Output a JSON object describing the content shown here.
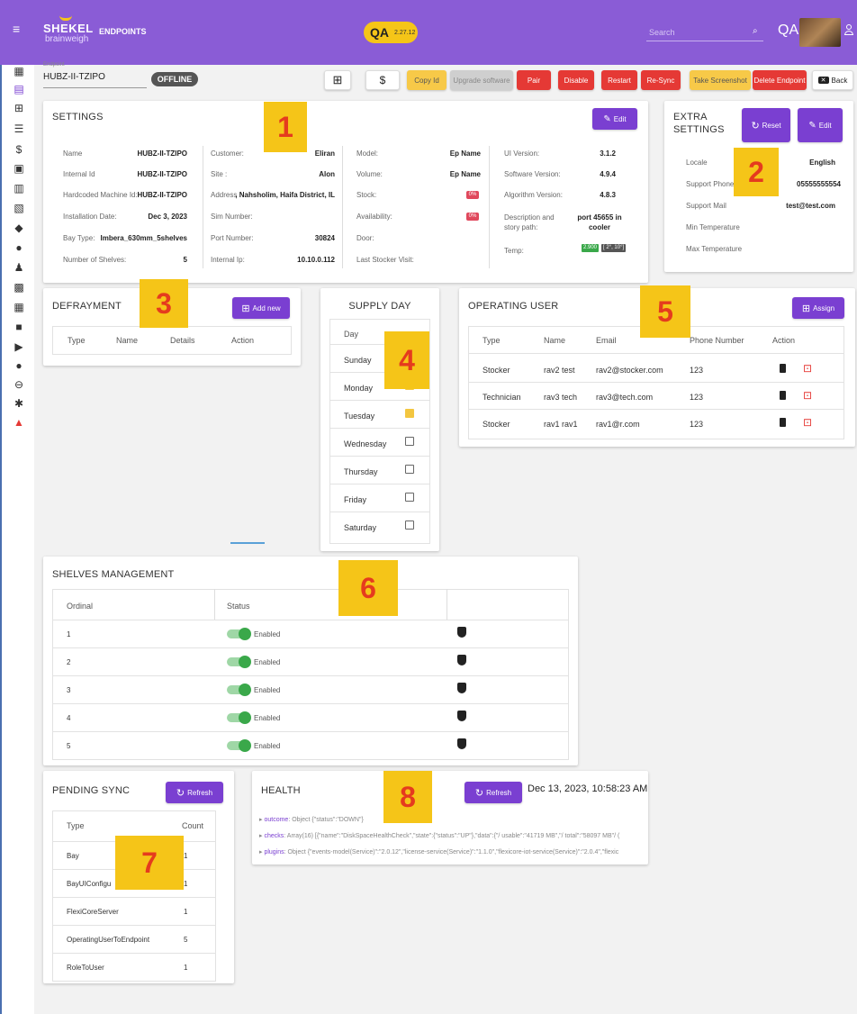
{
  "header": {
    "brand_main": "SHEKEL",
    "brand_sub": "brainweigh",
    "section": "ENDPOINTS",
    "env": "QA",
    "env_version": "2.27.12",
    "search_placeholder": "Search",
    "user_initials": "QA"
  },
  "endpoint": {
    "field_label": "Endpoint",
    "name": "HUBZ-II-TZIPO",
    "status": "OFFLINE"
  },
  "toolbar": {
    "copy_id": "Copy Id",
    "upgrade": "Upgrade software",
    "pair": "Pair",
    "disable": "Disable",
    "restart": "Restart",
    "resync": "Re-Sync",
    "screenshot": "Take Screenshot",
    "delete": "Delete Endpoint",
    "back": "Back",
    "dollar": "$"
  },
  "annotations": [
    "1",
    "2",
    "3",
    "4",
    "5",
    "6",
    "7",
    "8"
  ],
  "settings": {
    "title": "SETTINGS",
    "edit": "Edit",
    "col1": [
      {
        "label": "Name",
        "value": "HUBZ-II-TZIPO"
      },
      {
        "label": "Internal Id",
        "value": "HUBZ-II-TZIPO"
      },
      {
        "label": "Hardcoded Machine Id:",
        "value": "HUBZ-II-TZIPO"
      },
      {
        "label": "Installation Date:",
        "value": "Dec 3, 2023"
      },
      {
        "label": "Bay Type:",
        "value": "Imbera_630mm_5shelves"
      },
      {
        "label": "Number of Shelves:",
        "value": "5"
      }
    ],
    "col2": [
      {
        "label": "Customer:",
        "value": "Eliran"
      },
      {
        "label": "Site :",
        "value": "Alon"
      },
      {
        "label": "Address :",
        "value": ", Nahsholim, Haifa District, IL"
      },
      {
        "label": "Sim Number:",
        "value": ""
      },
      {
        "label": "Port Number:",
        "value": "30824"
      },
      {
        "label": "Internal Ip:",
        "value": "10.10.0.112"
      }
    ],
    "col3": [
      {
        "label": "Model:",
        "value": "Ep Name"
      },
      {
        "label": "Volume:",
        "value": "Ep Name"
      },
      {
        "label": "Stock:",
        "value": "0%"
      },
      {
        "label": "Availability:",
        "value": "0%"
      },
      {
        "label": "Door:",
        "value": ""
      },
      {
        "label": "Last Stocker Visit:",
        "value": ""
      }
    ],
    "col4": [
      {
        "label": "UI Version:",
        "value": "3.1.2"
      },
      {
        "label": "Software Version:",
        "value": "4.9.4"
      },
      {
        "label": "Algorithm Version:",
        "value": "4.8.3"
      },
      {
        "label": "Description and story path:",
        "value": "port 45655 in cooler"
      },
      {
        "label": "Temp:",
        "value": "2.900",
        "range": "[ 2°, 10°]"
      }
    ]
  },
  "extra": {
    "title_1": "EXTRA",
    "title_2": "SETTINGS",
    "reset": "Reset",
    "edit": "Edit",
    "rows": [
      {
        "label": "Locale",
        "value": "English"
      },
      {
        "label": "Support Phone",
        "value": "05555555554"
      },
      {
        "label": "Support Mail",
        "value": "test@test.com"
      },
      {
        "label": "Min Temperature",
        "value": ""
      },
      {
        "label": "Max Temperature",
        "value": ""
      }
    ]
  },
  "defrayment": {
    "title": "DEFRAYMENT",
    "add": "Add new",
    "headers": [
      "Type",
      "Name",
      "Details",
      "Action"
    ]
  },
  "supply": {
    "title": "SUPPLY DAY",
    "header": "Day",
    "days": [
      {
        "name": "Sunday",
        "checked": true
      },
      {
        "name": "Monday",
        "checked": true
      },
      {
        "name": "Tuesday",
        "checked": true
      },
      {
        "name": "Wednesday",
        "checked": false
      },
      {
        "name": "Thursday",
        "checked": false
      },
      {
        "name": "Friday",
        "checked": false
      },
      {
        "name": "Saturday",
        "checked": false
      }
    ]
  },
  "operating": {
    "title": "OPERATING USER",
    "assign": "Assign",
    "headers": [
      "Type",
      "Name",
      "Email",
      "Phone Number",
      "Action"
    ],
    "rows": [
      {
        "type": "Stocker",
        "name": "rav2 test",
        "email": "rav2@stocker.com",
        "phone": "123"
      },
      {
        "type": "Technician",
        "name": "rav3 tech",
        "email": "rav3@tech.com",
        "phone": "123"
      },
      {
        "type": "Stocker",
        "name": "rav1 rav1",
        "email": "rav1@r.com",
        "phone": "123"
      }
    ]
  },
  "shelves": {
    "title": "SHELVES MANAGEMENT",
    "headers": [
      "Ordinal",
      "Status"
    ],
    "rows": [
      {
        "ordinal": "1",
        "status": "Enabled"
      },
      {
        "ordinal": "2",
        "status": "Enabled"
      },
      {
        "ordinal": "3",
        "status": "Enabled"
      },
      {
        "ordinal": "4",
        "status": "Enabled"
      },
      {
        "ordinal": "5",
        "status": "Enabled"
      }
    ]
  },
  "pending": {
    "title": "PENDING SYNC",
    "refresh": "Refresh",
    "headers": [
      "Type",
      "Count"
    ],
    "rows": [
      {
        "type": "Bay",
        "count": "1"
      },
      {
        "type": "BayUIConfigu",
        "count": "1"
      },
      {
        "type": "FlexiCoreServer",
        "count": "1"
      },
      {
        "type": "OperatingUserToEndpoint",
        "count": "5"
      },
      {
        "type": "RoleToUser",
        "count": "1"
      }
    ]
  },
  "health": {
    "title": "HEALTH",
    "refresh": "Refresh",
    "timestamp": "Dec 13, 2023, 10:58:23 AM",
    "lines": [
      {
        "key": "outcome",
        "text": "Object {\"status\":\"DOWN\"}"
      },
      {
        "key": "checks",
        "text": "Array(16) [{\"name\":\"DiskSpaceHealthCheck\",\"state\":{\"status\":\"UP\"},\"data\":{\"/ usable\":\"41719 MB\",\"/ total\":\"58097 MB\"/ ("
      },
      {
        "key": "plugins",
        "text": "Object {\"events-model(Service)\":\"2.0.12\",\"license-service(Service)\":\"1.1.0\",\"flexicore-iot-service(Service)\":\"2.0.4\",\"flexic"
      }
    ]
  },
  "colors": {
    "header": "#8a5cd6",
    "primary": "#7a3fd1",
    "danger": "#e53935",
    "warning": "#f7c948",
    "highlight": "#f5c518"
  }
}
